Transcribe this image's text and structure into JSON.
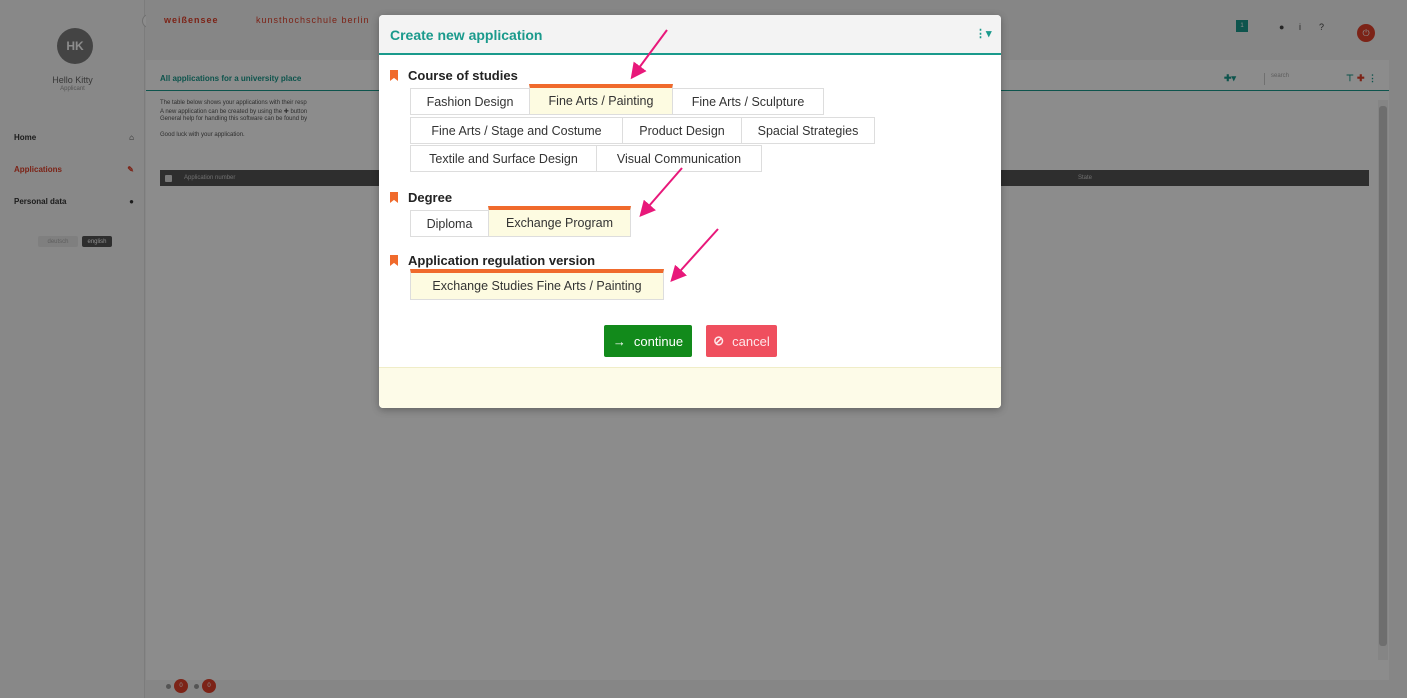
{
  "sidebar": {
    "avatar_initials": "HK",
    "greeting": "Hello Kitty",
    "greeting_sub": "Applicant",
    "nav": [
      {
        "label": "Home",
        "icon": "home-icon",
        "glyph": "⌂"
      },
      {
        "label": "Applications",
        "icon": "pencil-icon",
        "glyph": "✎"
      },
      {
        "label": "Personal data",
        "icon": "user-icon",
        "glyph": "●"
      }
    ],
    "lang_de": "deutsch",
    "lang_en": "english"
  },
  "topbar": {
    "brand_left": "weißensee",
    "brand_right": "kunsthochschule berlin",
    "notif_count": "1"
  },
  "content": {
    "section_title": "All applications for a university place",
    "search_placeholder": "search",
    "desc_lines": [
      "The table below shows your applications with their resp",
      "A new application can be created by using the ✚ button",
      "General help for handling this software can be found by",
      "Good luck with your application."
    ],
    "col_application_number": "Application number",
    "col_state": "State"
  },
  "footer": {
    "count_1": "0",
    "count_2": "0"
  },
  "modal": {
    "title": "Create new application",
    "menu_glyph": "⋮▾",
    "course": {
      "label": "Course of studies",
      "options": [
        "Fashion Design",
        "Fine Arts / Painting",
        "Fine Arts / Sculpture",
        "Fine Arts / Stage and Costume",
        "Product Design",
        "Spacial Strategies",
        "Textile and Surface Design",
        "Visual Communication"
      ],
      "selected": "Fine Arts / Painting"
    },
    "degree": {
      "label": "Degree",
      "options": [
        "Diploma",
        "Exchange Program"
      ],
      "selected": "Exchange Program"
    },
    "regulation": {
      "label": "Application regulation version",
      "options": [
        "Exchange Studies Fine Arts / Painting"
      ],
      "selected": "Exchange Studies Fine Arts / Painting"
    },
    "continue_label": "continue",
    "cancel_label": "cancel"
  },
  "colors": {
    "accent_teal": "#1a9a8c",
    "selection_orange": "#f06a2c",
    "continue_green": "#128a1b",
    "cancel_red": "#ef4f5e",
    "annotation_magenta": "#e8187a"
  }
}
